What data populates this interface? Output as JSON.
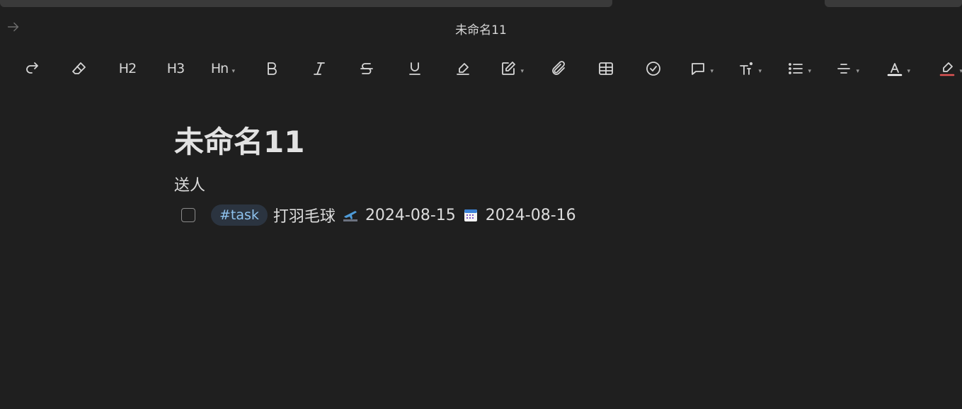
{
  "window": {
    "title": "未命名11"
  },
  "toolbar": {
    "h2": "H2",
    "h3": "H3",
    "hn": "Hn"
  },
  "document": {
    "heading": "未命名11",
    "paragraph": "送人",
    "task": {
      "tag": "#task",
      "text": "打羽毛球",
      "start_date": "2024-08-15",
      "due_date": "2024-08-16",
      "checked": false
    }
  },
  "colors": {
    "background": "#1f1f1f",
    "tag_bg": "#2b3440",
    "tag_text": "#8fc3ef",
    "font_color_bar": "#ffffff",
    "highlight_bar": "#e05555"
  }
}
